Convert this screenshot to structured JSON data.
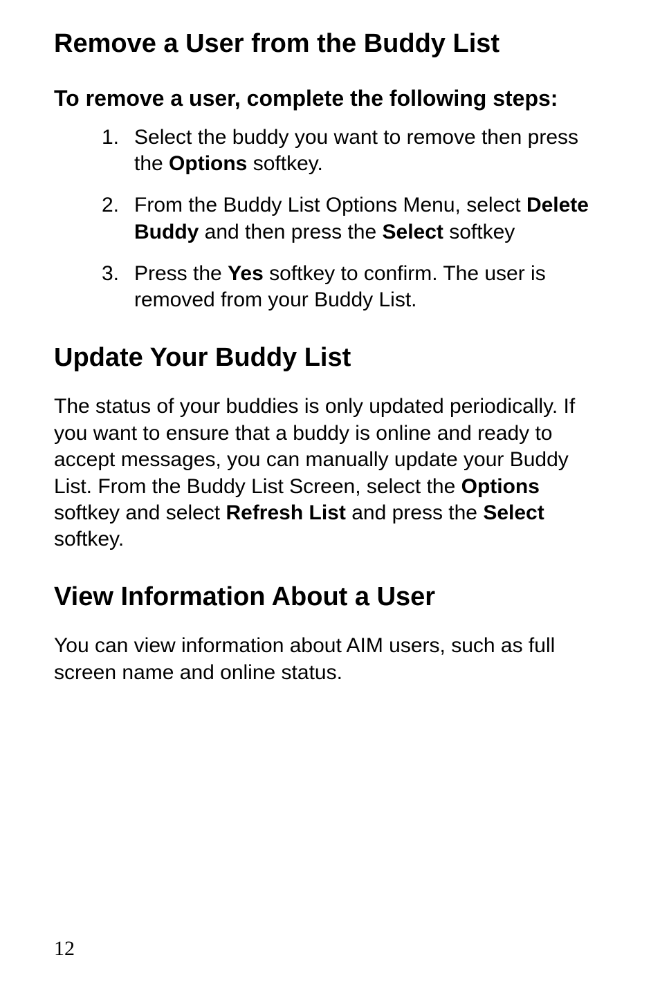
{
  "section1": {
    "title": "Remove a User from the Buddy List",
    "subtitle": "To remove a user, complete the following steps:",
    "steps": [
      {
        "num": "1.",
        "pre": "Select the buddy you want to remove then press the ",
        "bold1": "Options",
        "post": " softkey."
      },
      {
        "num": "2.",
        "pre": "From the Buddy List Options Menu, select ",
        "bold1": "Delete Buddy",
        "mid": " and then press the ",
        "bold2": "Select",
        "post": " softkey"
      },
      {
        "num": "3.",
        "pre": "Press the ",
        "bold1": "Yes",
        "post": " softkey to confirm. The user is removed from your Buddy List."
      }
    ]
  },
  "section2": {
    "title": "Update Your Buddy List",
    "para": {
      "p1": "The status of your buddies is only updated periodically. If you want to ensure that a buddy is online and ready to accept messages, you can manually update your Buddy List. From the Buddy List Screen, select the ",
      "b1": "Options",
      "p2": " softkey and select ",
      "b2": "Refresh List",
      "p3": " and press the ",
      "b3": "Select",
      "p4": " softkey."
    }
  },
  "section3": {
    "title": "View Information About a User",
    "para": "You can view information about AIM users, such as full screen name and online status."
  },
  "page_number": "12"
}
